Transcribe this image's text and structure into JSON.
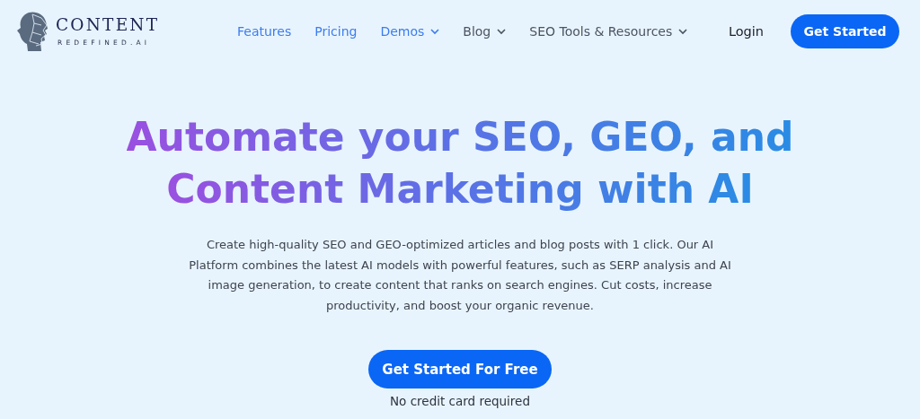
{
  "logo": {
    "name": "CONTENT",
    "tagline": "REDEFINED.AI"
  },
  "nav": [
    {
      "label": "Features",
      "has_menu": false,
      "color": "#3b7cf0"
    },
    {
      "label": "Pricing",
      "has_menu": false,
      "color": "#3b7cf0"
    },
    {
      "label": "Demos",
      "has_menu": true,
      "color": "#3b7cf0"
    },
    {
      "label": "Blog",
      "has_menu": true,
      "color": "#4a5363"
    },
    {
      "label": "SEO Tools & Resources",
      "has_menu": true,
      "color": "#4a5363"
    }
  ],
  "login": "Login",
  "cta": "Get Started",
  "hero": {
    "headline_lines": [
      "Automate your SEO, GEO, and",
      "Content Marketing with AI"
    ],
    "description": "Create high-quality SEO and GEO-optimized articles and blog posts with 1 click. Our AI Platform combines the latest AI models with powerful features, such as SERP analysis and AI image generation, to create content that ranks on search engines. Cut costs, increase productivity, and boost your organic revenue.",
    "button": "Get Started For Free",
    "note": "No credit card required"
  }
}
